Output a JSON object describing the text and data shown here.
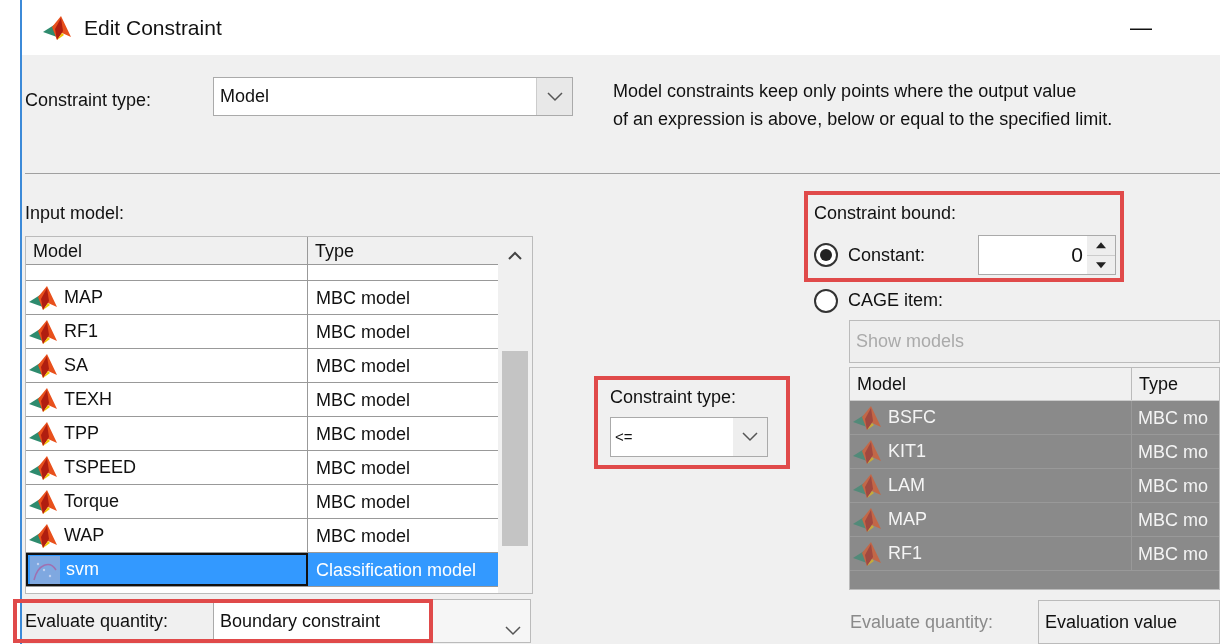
{
  "window": {
    "title": "Edit Constraint",
    "minimize": "—"
  },
  "constraint_type": {
    "label": "Constraint type:",
    "value": "Model"
  },
  "description": [
    "Model constraints keep only points where the output value",
    "of an expression is above, below or equal to the specified limit."
  ],
  "input_model": {
    "label": "Input model:",
    "columns": [
      "Model",
      "Type"
    ],
    "rows": [
      {
        "name": "MAP",
        "type": "MBC model",
        "kind": "mbc",
        "selected": false
      },
      {
        "name": "RF1",
        "type": "MBC model",
        "kind": "mbc",
        "selected": false
      },
      {
        "name": "SA",
        "type": "MBC model",
        "kind": "mbc",
        "selected": false
      },
      {
        "name": "TEXH",
        "type": "MBC model",
        "kind": "mbc",
        "selected": false
      },
      {
        "name": "TPP",
        "type": "MBC model",
        "kind": "mbc",
        "selected": false
      },
      {
        "name": "TSPEED",
        "type": "MBC model",
        "kind": "mbc",
        "selected": false
      },
      {
        "name": "Torque",
        "type": "MBC model",
        "kind": "mbc",
        "selected": false
      },
      {
        "name": "WAP",
        "type": "MBC model",
        "kind": "mbc",
        "selected": false
      },
      {
        "name": "svm",
        "type": "Classification model",
        "kind": "classification",
        "selected": true
      }
    ]
  },
  "operator": {
    "label": "Constraint type:",
    "value": "<="
  },
  "bound": {
    "label": "Constraint bound:",
    "options": [
      {
        "label": "Constant:",
        "selected": true
      },
      {
        "label": "CAGE item:",
        "selected": false
      }
    ],
    "constant": "0"
  },
  "cage": {
    "disabled": true,
    "filter": "Show models",
    "columns": [
      "Model",
      "Type"
    ],
    "rows": [
      {
        "name": "BSFC",
        "type": "MBC mo"
      },
      {
        "name": "KIT1",
        "type": "MBC mo"
      },
      {
        "name": "LAM",
        "type": "MBC mo"
      },
      {
        "name": "MAP",
        "type": "MBC mo"
      },
      {
        "name": "RF1",
        "type": "MBC mo"
      }
    ]
  },
  "evaluate_left": {
    "label": "Evaluate quantity:",
    "value": "Boundary constraint"
  },
  "evaluate_right": {
    "label": "Evaluate quantity:",
    "value": "Evaluation value",
    "disabled": true
  }
}
